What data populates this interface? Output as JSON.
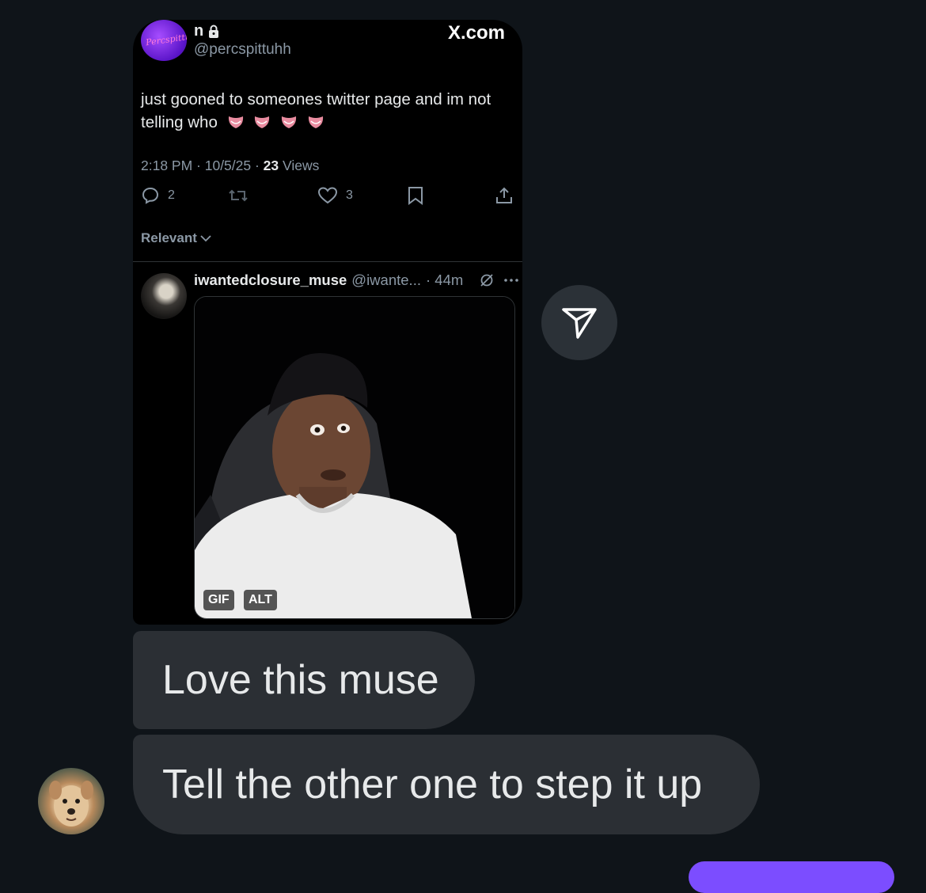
{
  "tweet": {
    "author_name": "n",
    "author_handle": "@percspittuhh",
    "source": "X.com",
    "avatar_text": "Percspittuh",
    "text": "just gooned to someones twitter page and im not telling who",
    "emoji_count": 4,
    "time": "2:18 PM · 10/5/25 · ",
    "views_count": "23",
    "views_label": " Views",
    "replies": "2",
    "likes": "3",
    "sort_label": "Relevant"
  },
  "reply": {
    "name": "iwantedclosure_muse",
    "handle": "@iwante...",
    "age": "· 44m",
    "badges": {
      "gif": "GIF",
      "alt": "ALT"
    }
  },
  "messages": [
    {
      "text": "Love this muse"
    },
    {
      "text": "Tell the other one to step it up"
    }
  ],
  "colors": {
    "background": "#0f1419",
    "bubble": "#2b2f34",
    "accent": "#7c4dff"
  }
}
